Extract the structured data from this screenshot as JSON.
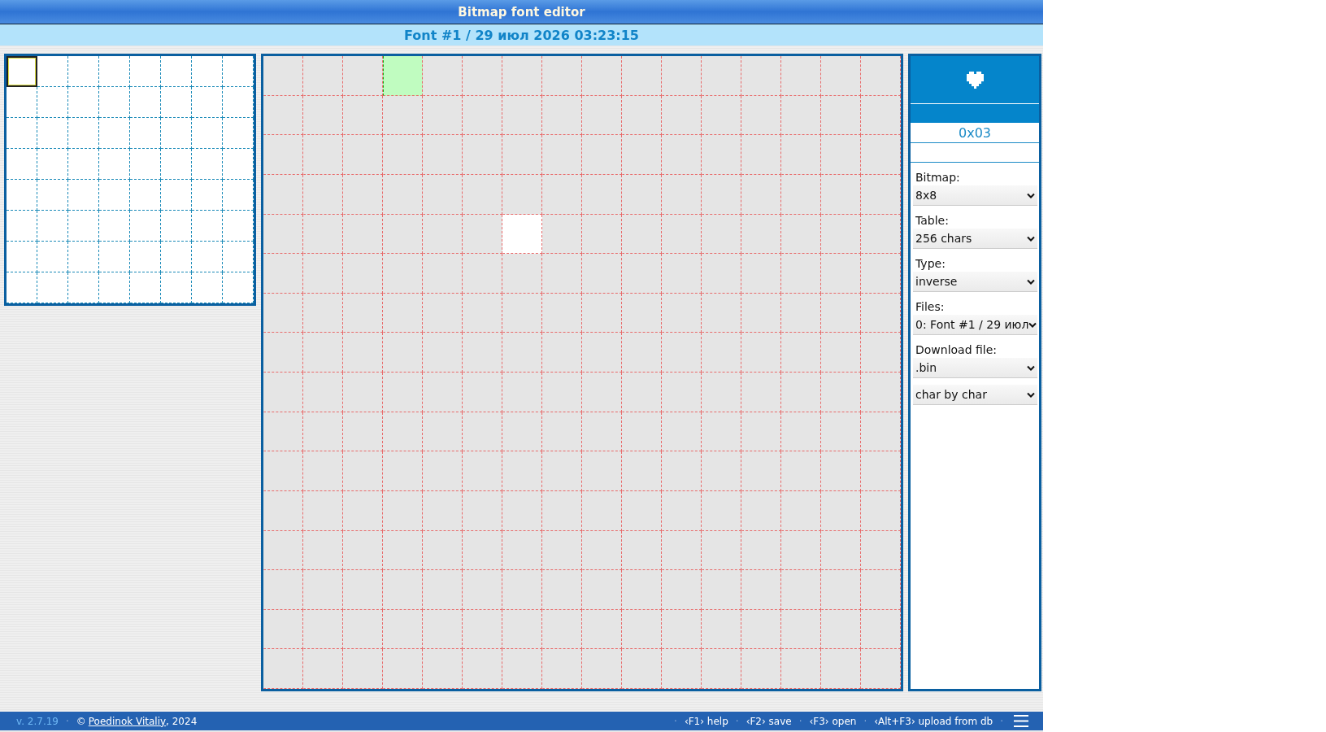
{
  "window": {
    "title": "Bitmap font editor"
  },
  "font_title": "Font #1 / 29 июл 2026 03:23:15",
  "char_table": {
    "cells": [
      {
        "selected": true
      },
      {
        "selected": false
      },
      {
        "selected": false
      },
      {
        "selected": false
      },
      {
        "selected": false
      },
      {
        "selected": false
      },
      {
        "selected": false
      },
      {
        "selected": false
      },
      {
        "selected": false
      },
      {
        "selected": false
      },
      {
        "selected": false
      },
      {
        "selected": false
      },
      {
        "selected": false
      },
      {
        "selected": false
      },
      {
        "selected": false
      },
      {
        "selected": false
      },
      {
        "selected": false
      },
      {
        "selected": false
      },
      {
        "selected": false
      },
      {
        "selected": false
      },
      {
        "selected": false
      },
      {
        "selected": false
      },
      {
        "selected": false
      },
      {
        "selected": false
      },
      {
        "selected": false
      },
      {
        "selected": false
      },
      {
        "selected": false
      },
      {
        "selected": false
      },
      {
        "selected": false
      },
      {
        "selected": false
      },
      {
        "selected": false
      },
      {
        "selected": false
      },
      {
        "selected": false
      },
      {
        "selected": false
      },
      {
        "selected": false
      },
      {
        "selected": false
      },
      {
        "selected": false
      },
      {
        "selected": false
      },
      {
        "selected": false
      },
      {
        "selected": false
      },
      {
        "selected": false
      },
      {
        "selected": false
      },
      {
        "selected": false
      },
      {
        "selected": false
      },
      {
        "selected": false
      },
      {
        "selected": false
      },
      {
        "selected": false
      },
      {
        "selected": false
      },
      {
        "selected": false
      },
      {
        "selected": false
      },
      {
        "selected": false
      },
      {
        "selected": false
      },
      {
        "selected": false
      },
      {
        "selected": false
      },
      {
        "selected": false
      },
      {
        "selected": false
      },
      {
        "selected": false
      },
      {
        "selected": false
      },
      {
        "selected": false
      },
      {
        "selected": false
      },
      {
        "selected": false
      },
      {
        "selected": false
      },
      {
        "selected": false
      },
      {
        "selected": false
      }
    ]
  },
  "editor": {
    "rows": [
      {
        "pixels": [
          false,
          false,
          false,
          false,
          false,
          false,
          false,
          false,
          false,
          false,
          false,
          false,
          false,
          false,
          false,
          false
        ],
        "cursor": [
          false,
          false,
          false,
          true,
          false,
          false,
          false,
          false,
          false,
          false,
          false,
          false,
          false,
          false,
          false,
          false
        ]
      },
      {
        "pixels": [
          false,
          false,
          false,
          false,
          false,
          false,
          false,
          false,
          false,
          false,
          false,
          false,
          false,
          false,
          false,
          false
        ],
        "cursor": [
          false,
          false,
          false,
          false,
          false,
          false,
          false,
          false,
          false,
          false,
          false,
          false,
          false,
          false,
          false,
          false
        ]
      },
      {
        "pixels": [
          false,
          false,
          false,
          false,
          false,
          false,
          false,
          false,
          false,
          false,
          false,
          false,
          false,
          false,
          false,
          false
        ],
        "cursor": [
          false,
          false,
          false,
          false,
          false,
          false,
          false,
          false,
          false,
          false,
          false,
          false,
          false,
          false,
          false,
          false
        ]
      },
      {
        "pixels": [
          false,
          false,
          false,
          false,
          false,
          false,
          false,
          false,
          false,
          false,
          false,
          false,
          false,
          false,
          false,
          false
        ],
        "cursor": [
          false,
          false,
          false,
          false,
          false,
          false,
          false,
          false,
          false,
          false,
          false,
          false,
          false,
          false,
          false,
          false
        ]
      },
      {
        "pixels": [
          false,
          false,
          false,
          false,
          false,
          false,
          true,
          false,
          false,
          false,
          false,
          false,
          false,
          false,
          false,
          false
        ],
        "cursor": [
          false,
          false,
          false,
          false,
          false,
          false,
          false,
          false,
          false,
          false,
          false,
          false,
          false,
          false,
          false,
          false
        ]
      },
      {
        "pixels": [
          false,
          false,
          false,
          false,
          false,
          false,
          false,
          false,
          false,
          false,
          false,
          false,
          false,
          false,
          false,
          false
        ],
        "cursor": [
          false,
          false,
          false,
          false,
          false,
          false,
          false,
          false,
          false,
          false,
          false,
          false,
          false,
          false,
          false,
          false
        ]
      },
      {
        "pixels": [
          false,
          false,
          false,
          false,
          false,
          false,
          false,
          false,
          false,
          false,
          false,
          false,
          false,
          false,
          false,
          false
        ],
        "cursor": [
          false,
          false,
          false,
          false,
          false,
          false,
          false,
          false,
          false,
          false,
          false,
          false,
          false,
          false,
          false,
          false
        ]
      },
      {
        "pixels": [
          false,
          false,
          false,
          false,
          false,
          false,
          false,
          false,
          false,
          false,
          false,
          false,
          false,
          false,
          false,
          false
        ],
        "cursor": [
          false,
          false,
          false,
          false,
          false,
          false,
          false,
          false,
          false,
          false,
          false,
          false,
          false,
          false,
          false,
          false
        ]
      },
      {
        "pixels": [
          false,
          false,
          false,
          false,
          false,
          false,
          false,
          false,
          false,
          false,
          false,
          false,
          false,
          false,
          false,
          false
        ],
        "cursor": [
          false,
          false,
          false,
          false,
          false,
          false,
          false,
          false,
          false,
          false,
          false,
          false,
          false,
          false,
          false,
          false
        ]
      },
      {
        "pixels": [
          false,
          false,
          false,
          false,
          false,
          false,
          false,
          false,
          false,
          false,
          false,
          false,
          false,
          false,
          false,
          false
        ],
        "cursor": [
          false,
          false,
          false,
          false,
          false,
          false,
          false,
          false,
          false,
          false,
          false,
          false,
          false,
          false,
          false,
          false
        ]
      },
      {
        "pixels": [
          false,
          false,
          false,
          false,
          false,
          false,
          false,
          false,
          false,
          false,
          false,
          false,
          false,
          false,
          false,
          false
        ],
        "cursor": [
          false,
          false,
          false,
          false,
          false,
          false,
          false,
          false,
          false,
          false,
          false,
          false,
          false,
          false,
          false,
          false
        ]
      },
      {
        "pixels": [
          false,
          false,
          false,
          false,
          false,
          false,
          false,
          false,
          false,
          false,
          false,
          false,
          false,
          false,
          false,
          false
        ],
        "cursor": [
          false,
          false,
          false,
          false,
          false,
          false,
          false,
          false,
          false,
          false,
          false,
          false,
          false,
          false,
          false,
          false
        ]
      },
      {
        "pixels": [
          false,
          false,
          false,
          false,
          false,
          false,
          false,
          false,
          false,
          false,
          false,
          false,
          false,
          false,
          false,
          false
        ],
        "cursor": [
          false,
          false,
          false,
          false,
          false,
          false,
          false,
          false,
          false,
          false,
          false,
          false,
          false,
          false,
          false,
          false
        ]
      },
      {
        "pixels": [
          false,
          false,
          false,
          false,
          false,
          false,
          false,
          false,
          false,
          false,
          false,
          false,
          false,
          false,
          false,
          false
        ],
        "cursor": [
          false,
          false,
          false,
          false,
          false,
          false,
          false,
          false,
          false,
          false,
          false,
          false,
          false,
          false,
          false,
          false
        ]
      },
      {
        "pixels": [
          false,
          false,
          false,
          false,
          false,
          false,
          false,
          false,
          false,
          false,
          false,
          false,
          false,
          false,
          false,
          false
        ],
        "cursor": [
          false,
          false,
          false,
          false,
          false,
          false,
          false,
          false,
          false,
          false,
          false,
          false,
          false,
          false,
          false,
          false
        ]
      },
      {
        "pixels": [
          false,
          false,
          false,
          false,
          false,
          false,
          false,
          false,
          false,
          false,
          false,
          false,
          false,
          false,
          false,
          false
        ],
        "cursor": [
          false,
          false,
          false,
          false,
          false,
          false,
          false,
          false,
          false,
          false,
          false,
          false,
          false,
          false,
          false,
          false
        ]
      }
    ]
  },
  "side_panel": {
    "char_code": "0x03",
    "selects": [
      {
        "label": "Bitmap:",
        "value": "8x8"
      },
      {
        "label": "Table:",
        "value": "256 chars"
      },
      {
        "label": "Type:",
        "value": "inverse"
      },
      {
        "label": "Files:",
        "value": "0: Font #1 / 29 июл"
      },
      {
        "label": "Download file:",
        "value": ".bin"
      },
      {
        "value": "char by char"
      }
    ]
  },
  "status_bar": {
    "version": "v. 2.7.19",
    "separator": "·",
    "copyright": "©",
    "author_link": "Poedinok Vitaliy",
    "year": ", 2024",
    "shortcuts": [
      {
        "separator": "·",
        "label": "‹F1› help"
      },
      {
        "separator": "·",
        "label": "‹F2› save"
      },
      {
        "separator": "·",
        "label": "‹F3› open"
      },
      {
        "separator": "·",
        "label": "‹Alt+F3› upload from db"
      }
    ],
    "end_separator": "·"
  }
}
